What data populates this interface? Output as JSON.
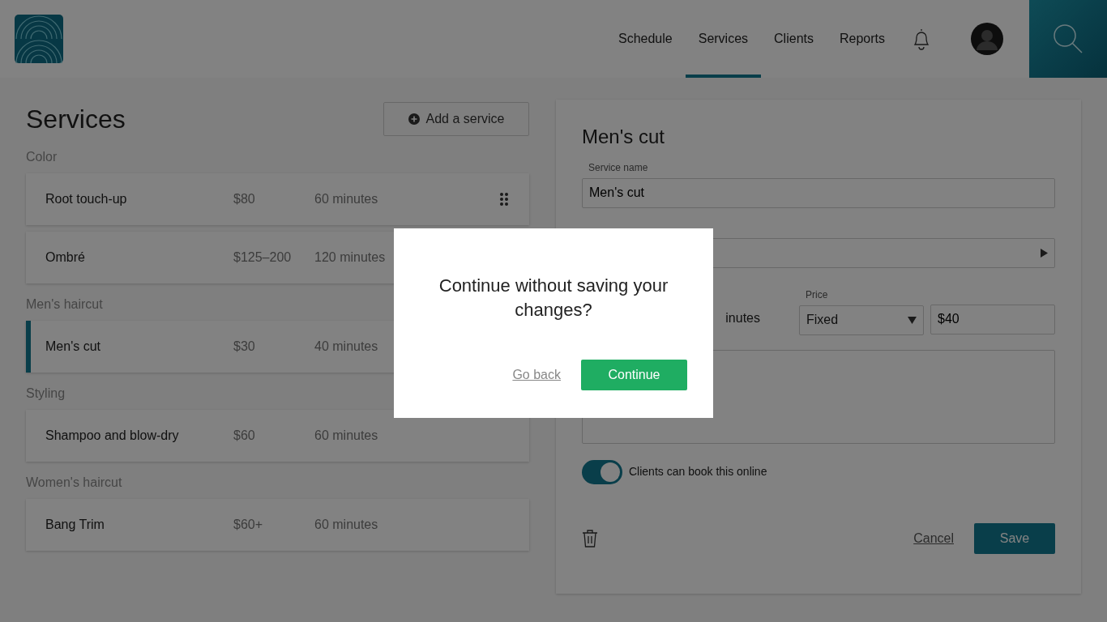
{
  "nav": {
    "links": [
      {
        "label": "Schedule",
        "selected": false
      },
      {
        "label": "Services",
        "selected": true
      },
      {
        "label": "Clients",
        "selected": false
      },
      {
        "label": "Reports",
        "selected": false
      }
    ]
  },
  "services": {
    "title": "Services",
    "add_button": "Add a service",
    "groups": [
      {
        "label": "Color",
        "items": [
          {
            "name": "Root touch-up",
            "price": "$80",
            "duration": "60 minutes",
            "selected": false,
            "hovered": true
          },
          {
            "name": "Ombré",
            "price": "$125–200",
            "duration": "120 minutes",
            "selected": false,
            "hovered": false
          }
        ]
      },
      {
        "label": "Men's haircut",
        "items": [
          {
            "name": "Men's cut",
            "price": "$30",
            "duration": "40 minutes",
            "selected": true,
            "hovered": false
          }
        ]
      },
      {
        "label": "Styling",
        "items": [
          {
            "name": "Shampoo and blow-dry",
            "price": "$60",
            "duration": "60 minutes",
            "selected": false,
            "hovered": false
          }
        ]
      },
      {
        "label": "Women's haircut",
        "items": [
          {
            "name": "Bang Trim",
            "price": "$60+",
            "duration": "60 minutes",
            "selected": false,
            "hovered": false
          }
        ]
      }
    ]
  },
  "editor": {
    "title": "Men's cut",
    "name_label": "Service name",
    "name_value": "Men's cut",
    "duration_fragment": "inutes",
    "price_label": "Price",
    "price_type": "Fixed",
    "price_value": "$40",
    "online_toggle": {
      "label": "Clients can book this online",
      "on": true
    },
    "cancel": "Cancel",
    "save": "Save"
  },
  "dialog": {
    "message": "Continue without saving your changes?",
    "back": "Go back",
    "confirm": "Continue"
  }
}
